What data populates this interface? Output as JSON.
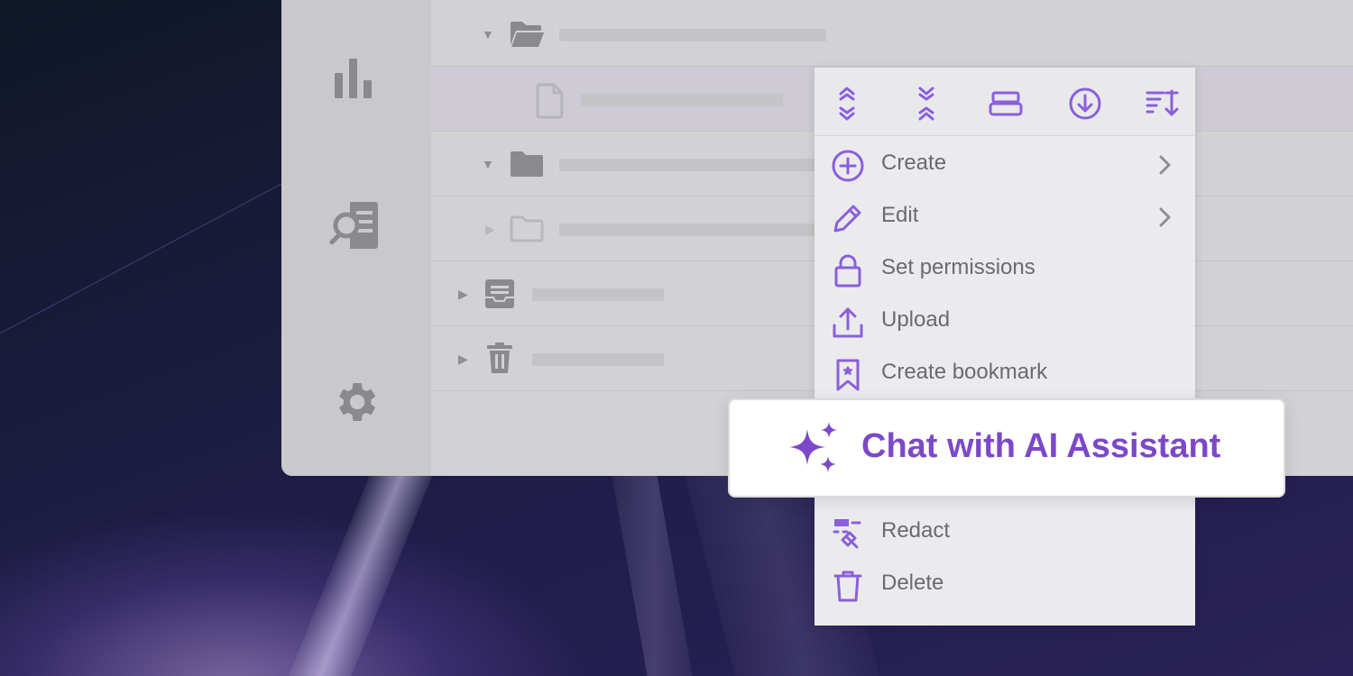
{
  "colors": {
    "accent": "#8a5fdc",
    "accent_strong": "#7c48c9",
    "menu_bg": "#ebebed",
    "window_bg": "#d2d2d4"
  },
  "rail": {
    "icons": [
      "bar-chart-icon",
      "document-search-icon",
      "gear-icon"
    ]
  },
  "tree": {
    "rows": [
      {
        "icon": "folder-open-icon",
        "state": "expanded"
      },
      {
        "icon": "file-icon",
        "state": "selected"
      },
      {
        "icon": "folder-icon",
        "state": "expanded"
      },
      {
        "icon": "folder-outline-icon",
        "state": "collapsed"
      },
      {
        "icon": "inbox-icon",
        "state": "collapsed"
      },
      {
        "icon": "trash-icon",
        "state": "collapsed"
      }
    ]
  },
  "menu": {
    "toolbar": [
      "expand-icon",
      "collapse-icon",
      "panel-icon",
      "download-circle-icon",
      "sort-icon"
    ],
    "items": [
      {
        "label": "Create",
        "icon": "plus-circle-icon",
        "submenu": true
      },
      {
        "label": "Edit",
        "icon": "pencil-icon",
        "submenu": true
      },
      {
        "label": "Set permissions",
        "icon": "lock-icon",
        "submenu": false
      },
      {
        "label": "Upload",
        "icon": "upload-icon",
        "submenu": false
      },
      {
        "label": "Create bookmark",
        "icon": "bookmark-icon",
        "submenu": false
      },
      {
        "label": "Redact",
        "icon": "redact-icon",
        "submenu": false
      },
      {
        "label": "Delete",
        "icon": "trash-icon",
        "submenu": false
      }
    ]
  },
  "ai_card": {
    "label": "Chat with AI Assistant",
    "icon": "sparkles-icon"
  }
}
